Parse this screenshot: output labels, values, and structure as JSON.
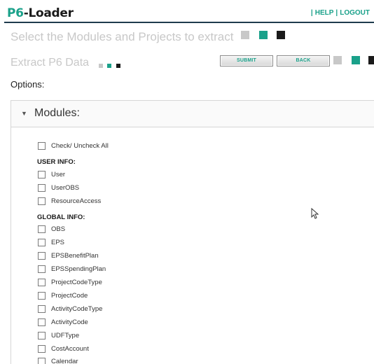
{
  "app": {
    "logo_part1": "P6",
    "logo_part2": "-Loader"
  },
  "top_links": {
    "help": "HELP",
    "logout": "LOGOUT",
    "separator": "|"
  },
  "headings": {
    "select_modules": "Select the Modules and Projects to extract",
    "extract": "Extract P6 Data"
  },
  "buttons": {
    "submit": "SUBMIT",
    "back": "BACK"
  },
  "options_label": "Options:",
  "modules_panel": {
    "title": "Modules:",
    "check_all": "Check/ Uncheck All",
    "user_info_label": "USER INFO:",
    "user_info_items": [
      "User",
      "UserOBS",
      "ResourceAccess"
    ],
    "global_info_label": "GLOBAL INFO:",
    "global_info_items": [
      "OBS",
      "EPS",
      "EPSBenefitPlan",
      "EPSSpendingPlan",
      "ProjectCodeType",
      "ProjectCode",
      "ActivityCodeType",
      "ActivityCode",
      "UDFType",
      "CostAccount",
      "Calendar"
    ]
  },
  "colors": {
    "accent": "#1aa18a",
    "dark": "#1a1a1a",
    "light_gray": "#c8c8c8"
  }
}
